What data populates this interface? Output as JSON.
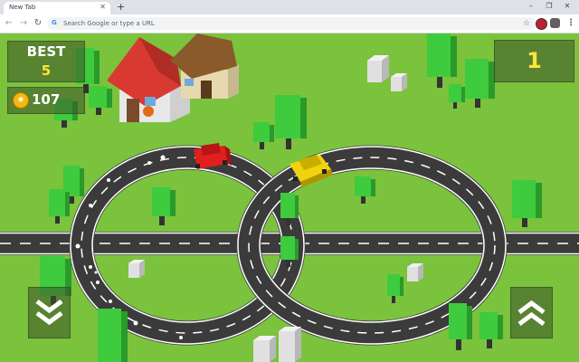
{
  "browser": {
    "tab_title": "New Tab",
    "tab_close_icon": "close-icon",
    "new_tab_label": "+",
    "omnibox_placeholder": "Search Google or type a URL",
    "icons": [
      "back-arrow-icon",
      "forward-arrow-icon",
      "reload-icon",
      "google-icon",
      "star-icon",
      "profile-icon",
      "puzzle-extension-icon",
      "menu-dots-icon"
    ]
  },
  "hud": {
    "best_label": "BEST",
    "best_value": "5",
    "coins": "107",
    "score": "1"
  },
  "controls": {
    "down_icon": "double-chevron-down-icon",
    "up_icon": "double-chevron-up-icon"
  },
  "colors": {
    "grass": "#7bc23d",
    "road": "#3b3b3b",
    "player_car": "#e01f1f",
    "rival_car": "#f0d20d",
    "hud_text": "#ffffff",
    "hud_value": "#ffe53a"
  }
}
